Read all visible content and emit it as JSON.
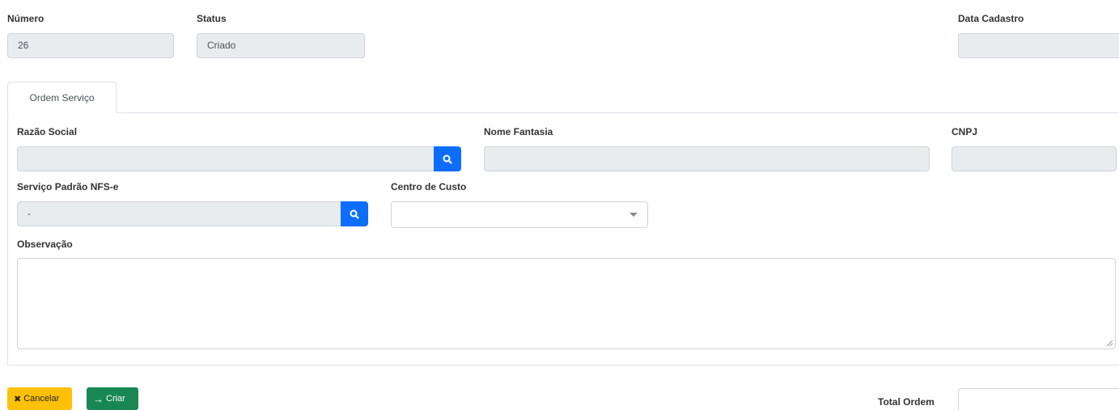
{
  "header": {
    "numero": {
      "label": "Número",
      "value": "26"
    },
    "status": {
      "label": "Status",
      "value": "Criado"
    },
    "data_cadastro": {
      "label": "Data Cadastro",
      "value": ""
    }
  },
  "tabs": [
    {
      "label": "Ordem Serviço",
      "active": true
    }
  ],
  "form": {
    "razao_social": {
      "label": "Razão Social",
      "value": ""
    },
    "nome_fantasia": {
      "label": "Nome Fantasia",
      "value": ""
    },
    "cnpj": {
      "label": "CNPJ",
      "value": ""
    },
    "servico_padrao": {
      "label": "Serviço Padrão NFS-e",
      "value": "-"
    },
    "centro_custo": {
      "label": "Centro de Custo",
      "value": ""
    },
    "observacao": {
      "label": "Observação",
      "value": ""
    }
  },
  "actions": {
    "cancel_label": "Cancelar",
    "create_label": "Criar"
  },
  "total": {
    "label": "Total Ordem",
    "value": ""
  },
  "icons": {
    "search": "search-icon",
    "cancel": "close-icon",
    "create": "arrow-right-icon",
    "select": "chevron-down-icon"
  },
  "colors": {
    "primary": "#0d6efd",
    "warning": "#ffc107",
    "success": "#198754",
    "readonly_bg": "#e9ecef"
  }
}
